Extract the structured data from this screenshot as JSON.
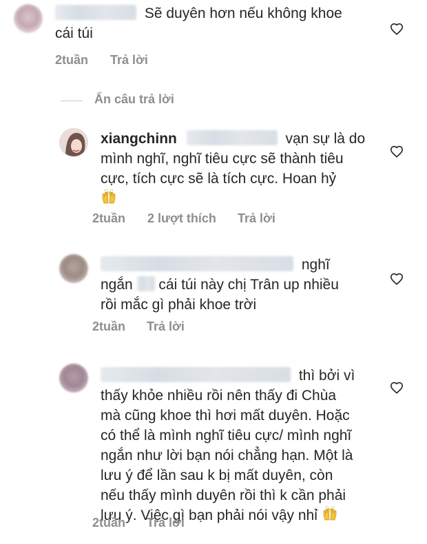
{
  "comments": [
    {
      "line1": "Sẽ duyên hơn nếu không khoe",
      "line2": "cái túi",
      "time": "2tuần",
      "reply": "Trả lời"
    },
    {
      "username": "xiangchinn",
      "line1_tail": "vạn sự là do",
      "line2": "mình nghĩ, nghĩ tiêu cực sẽ thành tiêu",
      "line3": "cực, tích cực sẽ là tích cực. Hoan hỷ",
      "time": "2tuần",
      "likes": "2 lượt thích",
      "reply": "Trả lời"
    },
    {
      "line1_tail": "nghĩ",
      "line2_head": "ngắn",
      "line2_tail": "cái túi này chị Trân up nhiều",
      "line3": "rồi mắc gì phải khoe trời",
      "time": "2tuần",
      "reply": "Trả lời"
    },
    {
      "line1_tail": "thì bởi vì",
      "line2": "thấy khỏe nhiều rồi nên thấy đi Chùa",
      "line3": "mà cũng khoe thì hơi mất duyên. Hoặc",
      "line4": "có thể là mình nghĩ tiêu cực/ mình nghĩ",
      "line5": "ngắn như lời bạn nói chẳng hạn. Một là",
      "line6": "lưu ý để lần sau k bị mất duyên, còn",
      "line7": "nếu thấy mình duyên rồi thì k cần phải",
      "line8": "lưu ý. Việc gì bạn phải nói vậy nhỉ",
      "time": "2tuần",
      "reply": "Trả lời"
    }
  ],
  "hide_replies": "Ẩn câu trả lời",
  "icons": {
    "like": "heart-icon",
    "emoji": "raising-hands-emoji"
  },
  "colors": {
    "text": "#262626",
    "meta": "#8e8e8e",
    "heart": "#262626",
    "emoji": "#f5c33b"
  }
}
